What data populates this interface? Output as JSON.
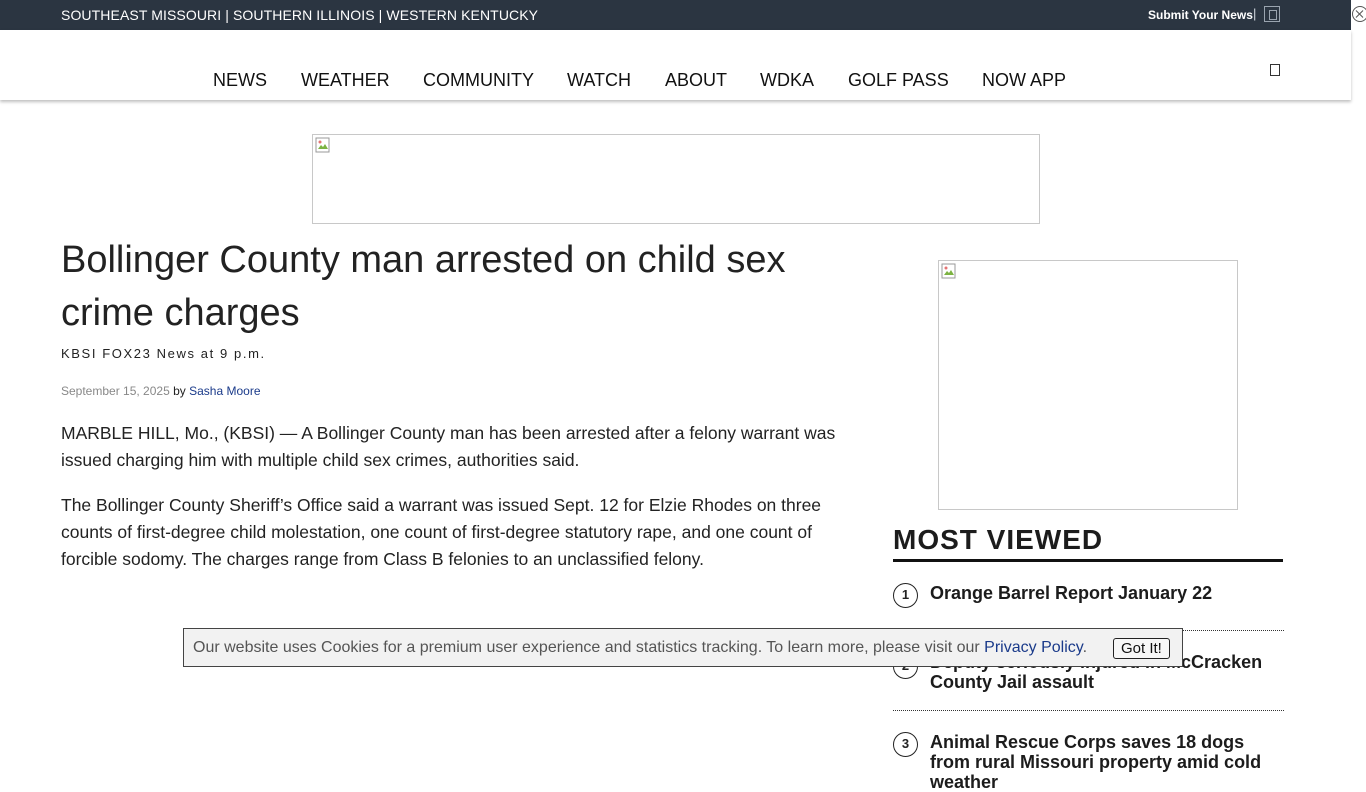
{
  "topbar": {
    "regions": "SOUTHEAST MISSOURI | SOUTHERN ILLINOIS | WESTERN KENTUCKY",
    "submit_label": "Submit Your News",
    "separator": "|",
    "icon": "square-icon"
  },
  "nav": {
    "items": [
      "NEWS",
      "WEATHER",
      "COMMUNITY",
      "WATCH",
      "ABOUT",
      "WDKA",
      "GOLF PASS",
      "NOW APP"
    ],
    "menu_icon": "square-icon"
  },
  "article": {
    "headline": "Bollinger County man arrested on child sex crime charges",
    "show": "KBSI FOX23 News at 9 p.m.",
    "date": "September 15, 2025",
    "by": "by",
    "author": "Sasha Moore",
    "paragraphs": [
      "MARBLE HILL, Mo., (KBSI) — A Bollinger County man has been arrested after a felony warrant was issued charging him with multiple child sex crimes, authorities said.",
      "The Bollinger County Sheriff’s Office said a warrant was issued Sept. 12 for Elzie Rhodes on three counts of first-degree child molestation, one count of first-degree statutory rape, and one count of forcible sodomy. The charges range from Class B felonies to an unclassified felony."
    ]
  },
  "most_viewed": {
    "title": "MOST VIEWED",
    "items": [
      {
        "num": "1",
        "title": "Orange Barrel Report January 22"
      },
      {
        "num": "2",
        "title": "Deputy seriously injured in McCracken County Jail assault"
      },
      {
        "num": "3",
        "title": "Animal Rescue Corps saves 18 dogs from rural Missouri property amid cold weather"
      }
    ]
  },
  "cookie": {
    "message": "Our website uses Cookies for a premium user experience and statistics tracking. To learn more, please visit our ",
    "link": "Privacy Policy",
    "period": ".",
    "button": "Got It!"
  }
}
